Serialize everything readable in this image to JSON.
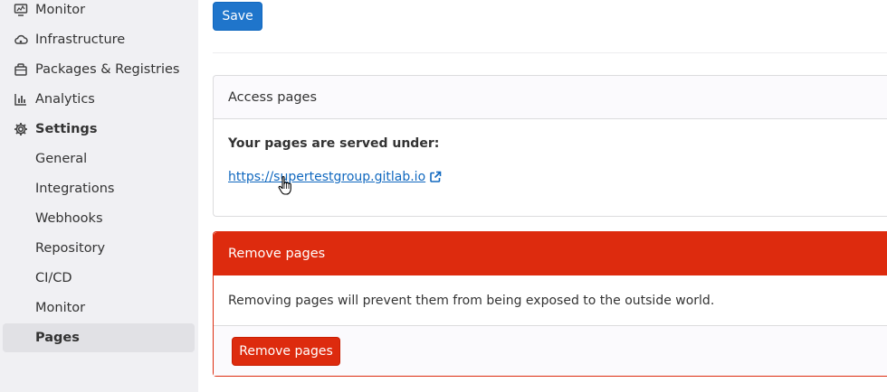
{
  "sidebar": {
    "items": [
      {
        "label": "Monitor",
        "icon": "monitor-icon"
      },
      {
        "label": "Infrastructure",
        "icon": "cloud-icon"
      },
      {
        "label": "Packages & Registries",
        "icon": "package-icon"
      },
      {
        "label": "Analytics",
        "icon": "chart-icon"
      },
      {
        "label": "Settings",
        "icon": "gear-icon"
      }
    ],
    "settings_sub": [
      {
        "label": "General"
      },
      {
        "label": "Integrations"
      },
      {
        "label": "Webhooks"
      },
      {
        "label": "Repository"
      },
      {
        "label": "CI/CD"
      },
      {
        "label": "Monitor"
      },
      {
        "label": "Pages"
      }
    ]
  },
  "toolbar": {
    "save_label": "Save"
  },
  "access": {
    "title": "Access pages",
    "served_label": "Your pages are served under:",
    "url": "https://supertestgroup.gitlab.io"
  },
  "remove": {
    "title": "Remove pages",
    "description": "Removing pages will prevent them from being exposed to the outside world.",
    "button_label": "Remove pages"
  },
  "colors": {
    "primary": "#1f75cb",
    "danger": "#dd2b0e",
    "link": "#1068bf",
    "sidebar_bg": "#f0f0f3"
  }
}
